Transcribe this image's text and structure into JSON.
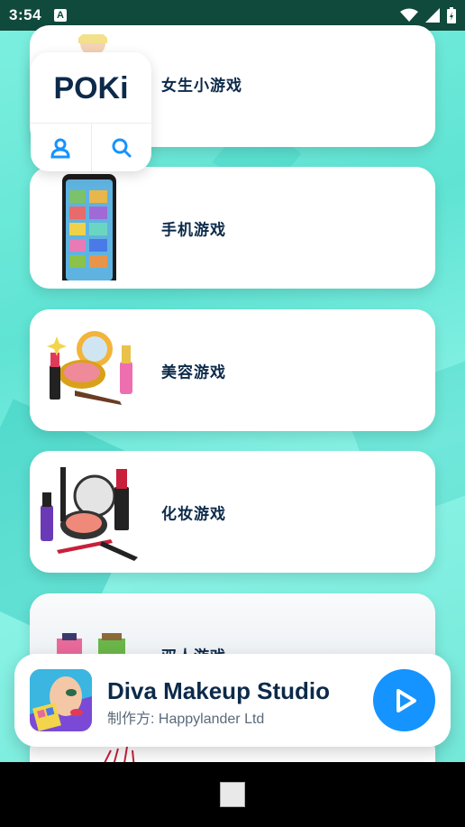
{
  "status": {
    "time": "3:54",
    "notif_letter": "A"
  },
  "poki": {
    "logo_text": "POKi"
  },
  "cards": [
    {
      "label": "女生小游戏"
    },
    {
      "label": "手机游戏"
    },
    {
      "label": "美容游戏"
    },
    {
      "label": "化妆游戏"
    },
    {
      "label": "双人游戏"
    }
  ],
  "banner": {
    "title": "Diva Makeup Studio",
    "subtitle": "制作方: Happylander Ltd"
  },
  "colors": {
    "accent": "#1593ff",
    "navy": "#0c2a4a",
    "status_bar": "#0f4a3c"
  }
}
